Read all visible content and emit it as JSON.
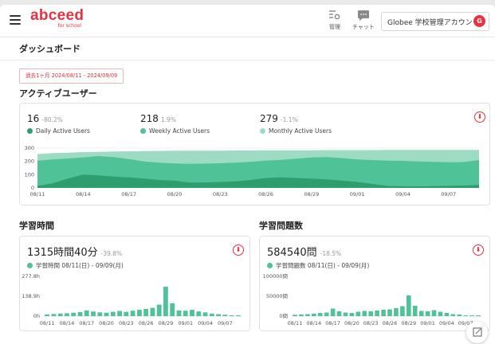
{
  "header": {
    "logo": "abceed",
    "logo_sub": "for school",
    "nav": [
      {
        "label": "管理",
        "icon": "settings-icon"
      },
      {
        "label": "チャット",
        "icon": "chat-icon"
      }
    ],
    "account_name": "Globee 学校管理アカウント",
    "avatar_letter": "G"
  },
  "page": {
    "title": "ダッシュボード",
    "date_range": "過去1ヶ月 2024/08/11 - 2024/09/09"
  },
  "active_users": {
    "title": "アクティブユーザー",
    "metrics": [
      {
        "value": "16",
        "change": "-80.2%",
        "legend": "Daily Active Users",
        "color": "#2f9e6e"
      },
      {
        "value": "218",
        "change": "1.9%",
        "legend": "Weekly Active Users",
        "color": "#4fc397"
      },
      {
        "value": "279",
        "change": "-1.1%",
        "legend": "Monthly Active Users",
        "color": "#9ddcc3"
      }
    ]
  },
  "study_time": {
    "title": "学習時間",
    "value": "1315時間40分",
    "change": "-39.8%",
    "legend": "学習時間 08/11(日) - 09/09(月)"
  },
  "study_questions": {
    "title": "学習問題数",
    "value": "584540問",
    "change": "-18.5%",
    "legend": "学習問題数 08/11(日) - 09/09(月)"
  },
  "chart_data": [
    {
      "type": "area",
      "x_ticks": [
        "08/11",
        "08/14",
        "08/17",
        "08/20",
        "08/23",
        "08/26",
        "08/29",
        "09/01",
        "09/04",
        "09/07"
      ],
      "y_ticks": [
        "300",
        "200",
        "100",
        "0"
      ],
      "ylim": [
        0,
        300
      ],
      "series": [
        {
          "name": "Monthly Active Users",
          "color": "#9ddcc3",
          "values": [
            255,
            262,
            266,
            270,
            272,
            274,
            276,
            278,
            279,
            280,
            280,
            281,
            281,
            282,
            282,
            283,
            283,
            284,
            284,
            285,
            285,
            285,
            285,
            286,
            286,
            286,
            286,
            286,
            286,
            287
          ]
        },
        {
          "name": "Weekly Active Users",
          "color": "#4fc397",
          "values": [
            205,
            215,
            222,
            230,
            240,
            232,
            218,
            200,
            190,
            185,
            182,
            183,
            186,
            190,
            196,
            205,
            212,
            220,
            230,
            232,
            225,
            215,
            210,
            206,
            204,
            200,
            196,
            194,
            195,
            210
          ]
        },
        {
          "name": "Daily Active Users",
          "color": "#2f9e6e",
          "values": [
            15,
            35,
            70,
            100,
            95,
            85,
            80,
            70,
            60,
            55,
            40,
            40,
            45,
            50,
            60,
            75,
            80,
            75,
            70,
            65,
            55,
            45,
            30,
            15,
            12,
            12,
            14,
            16,
            18,
            22
          ]
        }
      ]
    },
    {
      "type": "bar",
      "x_ticks": [
        "08/11",
        "08/14",
        "08/17",
        "08/20",
        "08/23",
        "08/26",
        "08/29",
        "09/01",
        "09/04",
        "09/07"
      ],
      "y_ticks": [
        "277.8h",
        "138.9h",
        "0h"
      ],
      "ylim": [
        0,
        277.8
      ],
      "color": "#4fc397",
      "values": [
        12,
        15,
        18,
        20,
        24,
        28,
        40,
        32,
        26,
        24,
        30,
        36,
        30,
        38,
        44,
        50,
        58,
        80,
        205,
        90,
        40,
        38,
        44,
        32,
        26,
        18,
        14,
        10,
        6,
        4
      ]
    },
    {
      "type": "bar",
      "x_ticks": [
        "08/11",
        "08/14",
        "08/17",
        "08/20",
        "08/23",
        "08/26",
        "08/29",
        "09/01",
        "09/04",
        "09/07"
      ],
      "y_ticks": [
        "100000問",
        "50000問",
        "0問"
      ],
      "ylim": [
        0,
        100000
      ],
      "color": "#4fc397",
      "values": [
        3500,
        4500,
        5000,
        6000,
        8000,
        9000,
        19000,
        12000,
        9000,
        8000,
        11000,
        13000,
        12000,
        14000,
        16000,
        17000,
        20000,
        25000,
        52000,
        26000,
        13000,
        12000,
        15000,
        11000,
        8000,
        5000,
        4000,
        2000,
        1500,
        1000
      ]
    }
  ]
}
